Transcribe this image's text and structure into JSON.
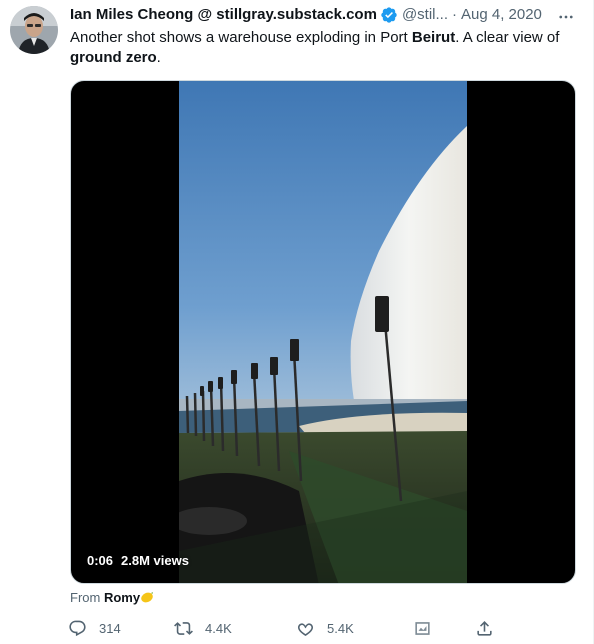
{
  "author": {
    "display_name": "Ian Miles Cheong @ stillgray.substack.com",
    "handle": "@stil...",
    "separator": "·",
    "date": "Aug 4, 2020",
    "verified": true,
    "avatar_icon": "avatar-photo"
  },
  "tweet": {
    "text_part1": "Another shot shows a warehouse exploding in Port ",
    "text_bold1": "Beirut",
    "text_part2": ". A clear view of ",
    "text_bold2": "ground zero",
    "text_part3": "."
  },
  "media": {
    "duration": "0:06",
    "views": "2.8M views"
  },
  "attribution": {
    "prefix": "From",
    "user": "Romy",
    "emoji_icon": "lemon-icon"
  },
  "actions": {
    "reply_count": "314",
    "retweet_count": "4.4K",
    "like_count": "5.4K"
  },
  "colors": {
    "text_primary": "#0f1419",
    "text_secondary": "#536471",
    "verified_blue": "#1d9bf0",
    "media_border": "#cfd9de"
  }
}
